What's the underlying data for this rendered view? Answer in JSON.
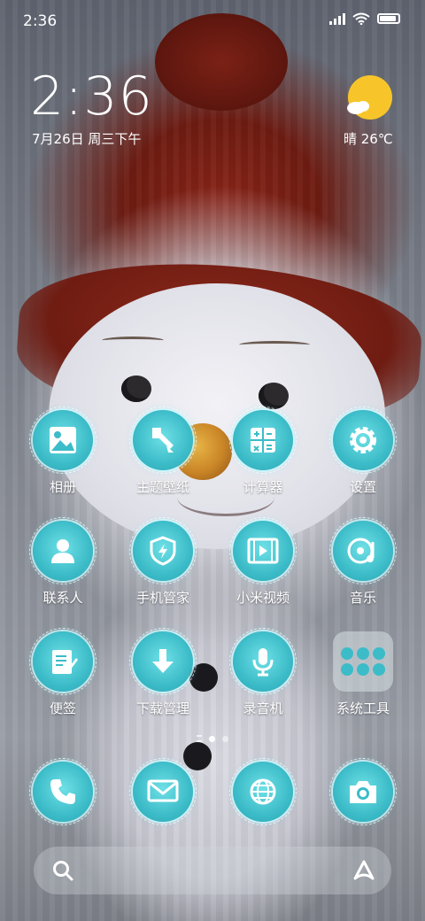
{
  "status_bar": {
    "time": "2:36"
  },
  "clock_widget": {
    "time": "2:36",
    "date": "7月26日 周三下午"
  },
  "weather": {
    "text": "晴 26℃",
    "icon": "sun-cloud-icon",
    "sun_color": "#f7c52a"
  },
  "apps_row1": [
    {
      "label": "相册",
      "icon": "gallery-icon"
    },
    {
      "label": "主题壁纸",
      "icon": "themes-brush-icon"
    },
    {
      "label": "计算器",
      "icon": "calculator-icon"
    },
    {
      "label": "设置",
      "icon": "gear-icon"
    }
  ],
  "apps_row2": [
    {
      "label": "联系人",
      "icon": "contacts-icon"
    },
    {
      "label": "手机管家",
      "icon": "security-shield-icon"
    },
    {
      "label": "小米视频",
      "icon": "video-icon"
    },
    {
      "label": "音乐",
      "icon": "music-icon"
    }
  ],
  "apps_row3": [
    {
      "label": "便签",
      "icon": "notes-icon"
    },
    {
      "label": "下载管理",
      "icon": "download-icon"
    },
    {
      "label": "录音机",
      "icon": "microphone-icon"
    },
    {
      "label": "系统工具",
      "icon": "folder-icon"
    }
  ],
  "dock": [
    {
      "icon": "phone-icon"
    },
    {
      "icon": "message-icon"
    },
    {
      "icon": "browser-icon"
    },
    {
      "icon": "camera-icon"
    }
  ],
  "page_indicator": {
    "pages": 2,
    "active": 1
  },
  "search_bar": {
    "left_icon": "search-icon",
    "right_icon": "assistant-icon"
  },
  "colors": {
    "icon_teal": "#3cbcc8",
    "icon_glow": "#6fe0e6"
  }
}
